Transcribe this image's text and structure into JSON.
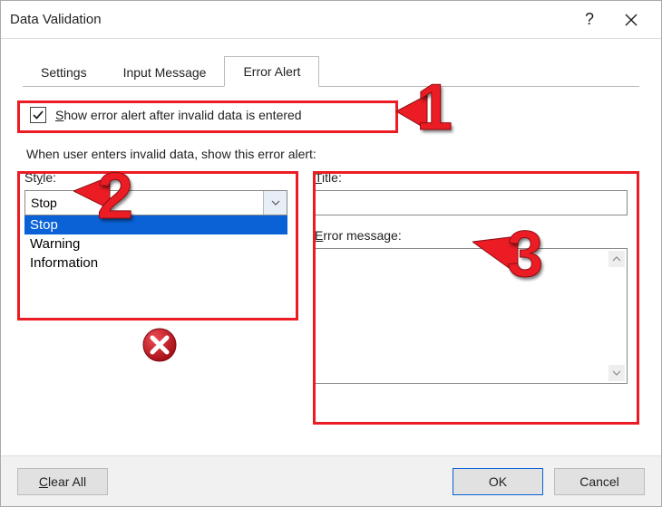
{
  "dialog": {
    "title": "Data Validation",
    "tabs": [
      "Settings",
      "Input Message",
      "Error Alert"
    ],
    "active_tab": 2,
    "checkbox_label": "Show error alert after invalid data is entered",
    "checkbox_checked": true,
    "section_label": "When user enters invalid data, show this error alert:",
    "style_label": "Style:",
    "style_value": "Stop",
    "style_options": [
      "Stop",
      "Warning",
      "Information"
    ],
    "title_label": "Title:",
    "title_value": "",
    "error_label": "Error message:",
    "error_value": "",
    "buttons": {
      "clear_all": "Clear All",
      "ok": "OK",
      "cancel": "Cancel"
    }
  },
  "annotations": {
    "c1": "1",
    "c2": "2",
    "c3": "3"
  }
}
